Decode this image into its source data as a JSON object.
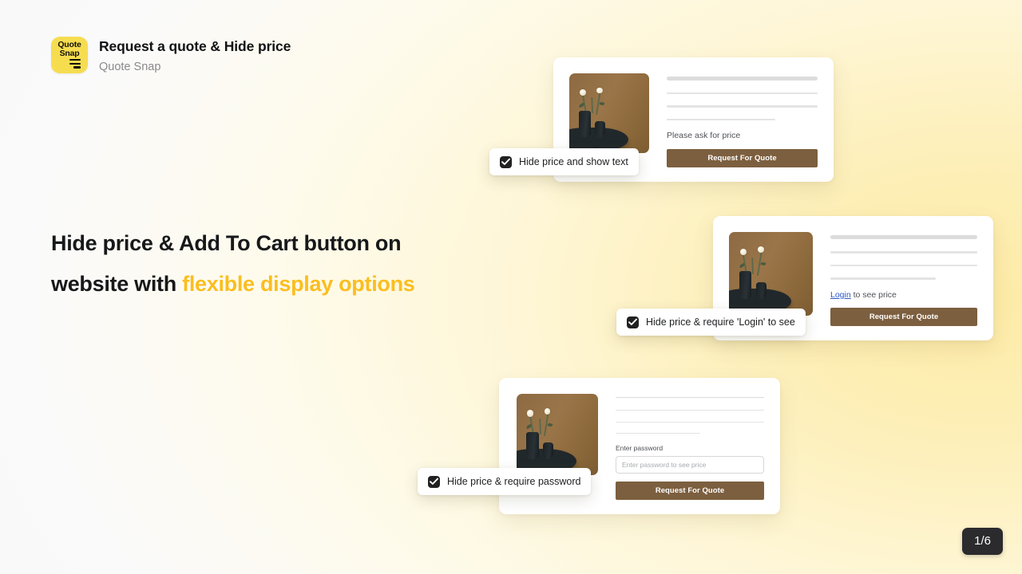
{
  "app": {
    "logo_line1": "Quote",
    "logo_line2": "Snap",
    "logo_icon": "quote-snap-logo",
    "title": "Request a quote & Hide price",
    "subtitle": "Quote Snap"
  },
  "headline": {
    "line1": "Hide price & Add To Cart button on",
    "line2_plain": "website with ",
    "line2_accent": "flexible display options",
    "accent_color": "#fbbe20"
  },
  "colors": {
    "background_left": "#f7f7f7",
    "background_right": "#fdeba6",
    "button": "#7c5f3f",
    "link": "#2b58c9",
    "checkbox": "#212121",
    "badge": "#2b2b2d"
  },
  "cards": [
    {
      "id": "hide-price-show-text",
      "price_note": "Please ask for price",
      "button_label": "Request For Quote",
      "checkbox": {
        "label": "Hide price and show text",
        "checked": true
      }
    },
    {
      "id": "hide-price-require-login",
      "price_note_link": "Login",
      "price_note_rest": " to see price",
      "button_label": "Request For Quote",
      "checkbox": {
        "label": "Hide price & require 'Login' to see",
        "checked": true
      }
    },
    {
      "id": "hide-price-require-password",
      "password_label": "Enter password",
      "password_placeholder": "Enter password to see price",
      "password_value": "",
      "button_label": "Request For Quote",
      "checkbox": {
        "label": "Hide price & require password",
        "checked": true
      }
    }
  ],
  "pagination": {
    "counter": "1/6"
  }
}
